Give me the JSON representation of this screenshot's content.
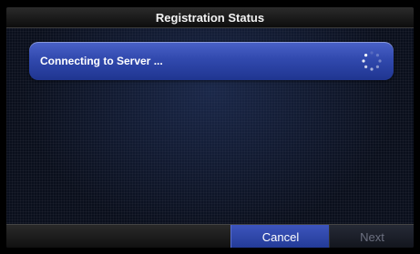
{
  "title_bar": {
    "title": "Registration Status"
  },
  "status": {
    "message": "Connecting to Server ...",
    "indicator": "loading-spinner-icon"
  },
  "footer": {
    "cancel_label": "Cancel",
    "next_label": "Next",
    "next_enabled": false
  },
  "colors": {
    "accent": "#3149ae",
    "background": "#0a0f1c",
    "bar": "#1a1a1a",
    "disabled_text": "#6c7080"
  }
}
